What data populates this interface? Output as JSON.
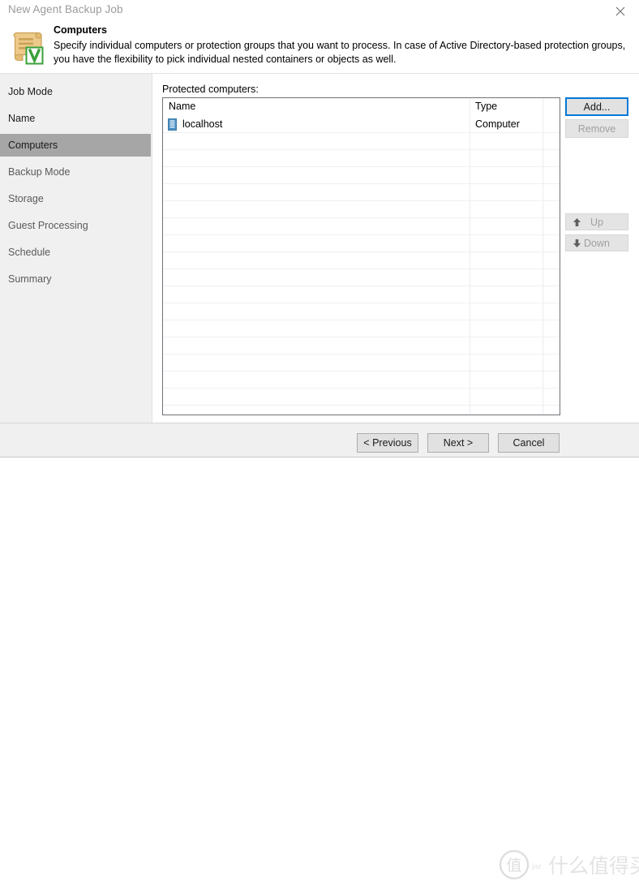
{
  "window": {
    "title": "New Agent Backup Job",
    "close_icon": "close-icon"
  },
  "header": {
    "icon": "scroll-veeam-icon",
    "title": "Computers",
    "description": "Specify individual computers or protection groups that you want to process. In case of Active Directory-based protection groups, you have the flexibility to pick individual nested containers or objects as well."
  },
  "sidebar": {
    "items": [
      {
        "label": "Job Mode",
        "active": false,
        "strong": true
      },
      {
        "label": "Name",
        "active": false,
        "strong": true
      },
      {
        "label": "Computers",
        "active": true,
        "strong": true
      },
      {
        "label": "Backup Mode",
        "active": false,
        "strong": false
      },
      {
        "label": "Storage",
        "active": false,
        "strong": false
      },
      {
        "label": "Guest Processing",
        "active": false,
        "strong": false
      },
      {
        "label": "Schedule",
        "active": false,
        "strong": false
      },
      {
        "label": "Summary",
        "active": false,
        "strong": false
      }
    ]
  },
  "main": {
    "list_label": "Protected computers:",
    "table": {
      "columns": [
        "Name",
        "Type"
      ],
      "rows": [
        {
          "icon": "server-icon",
          "name": "localhost",
          "type": "Computer"
        }
      ],
      "empty_row_count": 17
    },
    "buttons": {
      "add": {
        "label": "Add...",
        "enabled": true,
        "focused": true
      },
      "remove": {
        "label": "Remove",
        "enabled": false,
        "focused": false
      },
      "up": {
        "label": "Up",
        "enabled": false,
        "icon": "arrow-up-icon"
      },
      "down": {
        "label": "Down",
        "enabled": false,
        "icon": "arrow-down-icon"
      }
    }
  },
  "footer": {
    "previous_label": "< Previous",
    "next_label": "Next >",
    "cancel_label": "Cancel"
  },
  "colors": {
    "accent": "#0078d7",
    "sidebar_bg": "#f0f0f0",
    "active_item_bg": "#a6a6a6",
    "icon_blue": "#4a90c4",
    "icon_gold": "#e8c37a",
    "icon_green": "#3aa03a"
  }
}
